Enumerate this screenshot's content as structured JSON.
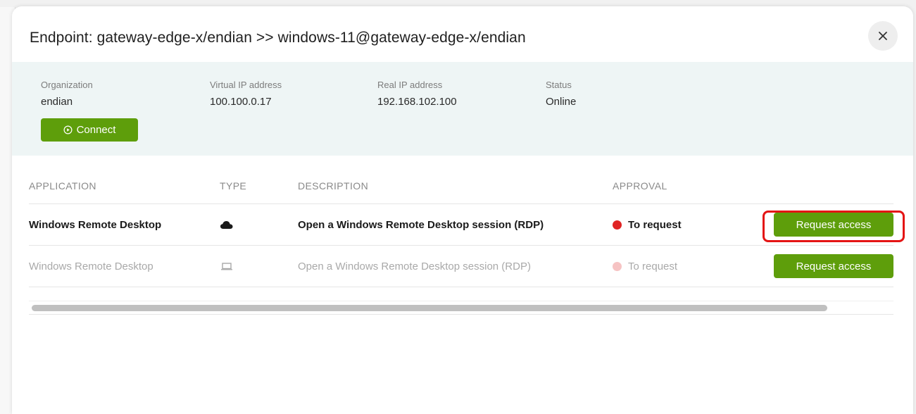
{
  "modal": {
    "title": "Endpoint: gateway-edge-x/endian >> windows-11@gateway-edge-x/endian",
    "close_icon": "close-icon"
  },
  "info": {
    "organization": {
      "label": "Organization",
      "value": "endian"
    },
    "virtual_ip": {
      "label": "Virtual IP address",
      "value": "100.100.0.17"
    },
    "real_ip": {
      "label": "Real IP address",
      "value": "192.168.102.100"
    },
    "status": {
      "label": "Status",
      "value": "Online"
    },
    "connect_label": "Connect",
    "connect_icon": "play-circle-icon"
  },
  "table": {
    "headers": {
      "application": "APPLICATION",
      "type": "TYPE",
      "description": "DESCRIPTION",
      "approval": "APPROVAL"
    },
    "rows": [
      {
        "application": "Windows Remote Desktop",
        "type_icon": "cloud-icon",
        "description": "Open a Windows Remote Desktop session (RDP)",
        "approval": "To request",
        "approval_color": "#e02424",
        "action": "Request access"
      },
      {
        "application": "Windows Remote Desktop",
        "type_icon": "laptop-icon",
        "description": "Open a Windows Remote Desktop session (RDP)",
        "approval": "To request",
        "approval_color": "#f6c3c3",
        "action": "Request access"
      }
    ]
  },
  "colors": {
    "accent": "#5e9e0b",
    "highlight": "#e41414",
    "info_band": "#eef5f5"
  }
}
